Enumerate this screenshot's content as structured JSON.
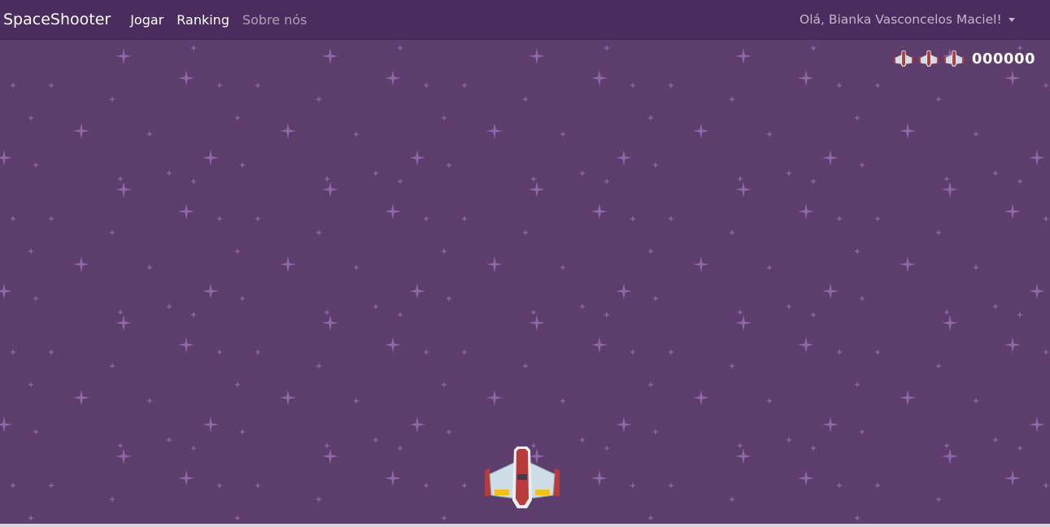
{
  "navbar": {
    "brand": "SpaceShooter",
    "links": [
      {
        "label": "Jogar"
      },
      {
        "label": "Ranking"
      },
      {
        "label": "Sobre nós"
      }
    ],
    "user_greeting": "Olá, Bianka Vasconcelos Maciel!"
  },
  "hud": {
    "lives": 3,
    "score": "000000"
  },
  "colors": {
    "navbar_bg": "#4b2c5e",
    "game_bg": "#5c3d6b",
    "star": "#9a6fb5",
    "ship_body": "#b83a3a",
    "ship_wing": "#cfdde6",
    "ship_thruster": "#f2c21a"
  }
}
